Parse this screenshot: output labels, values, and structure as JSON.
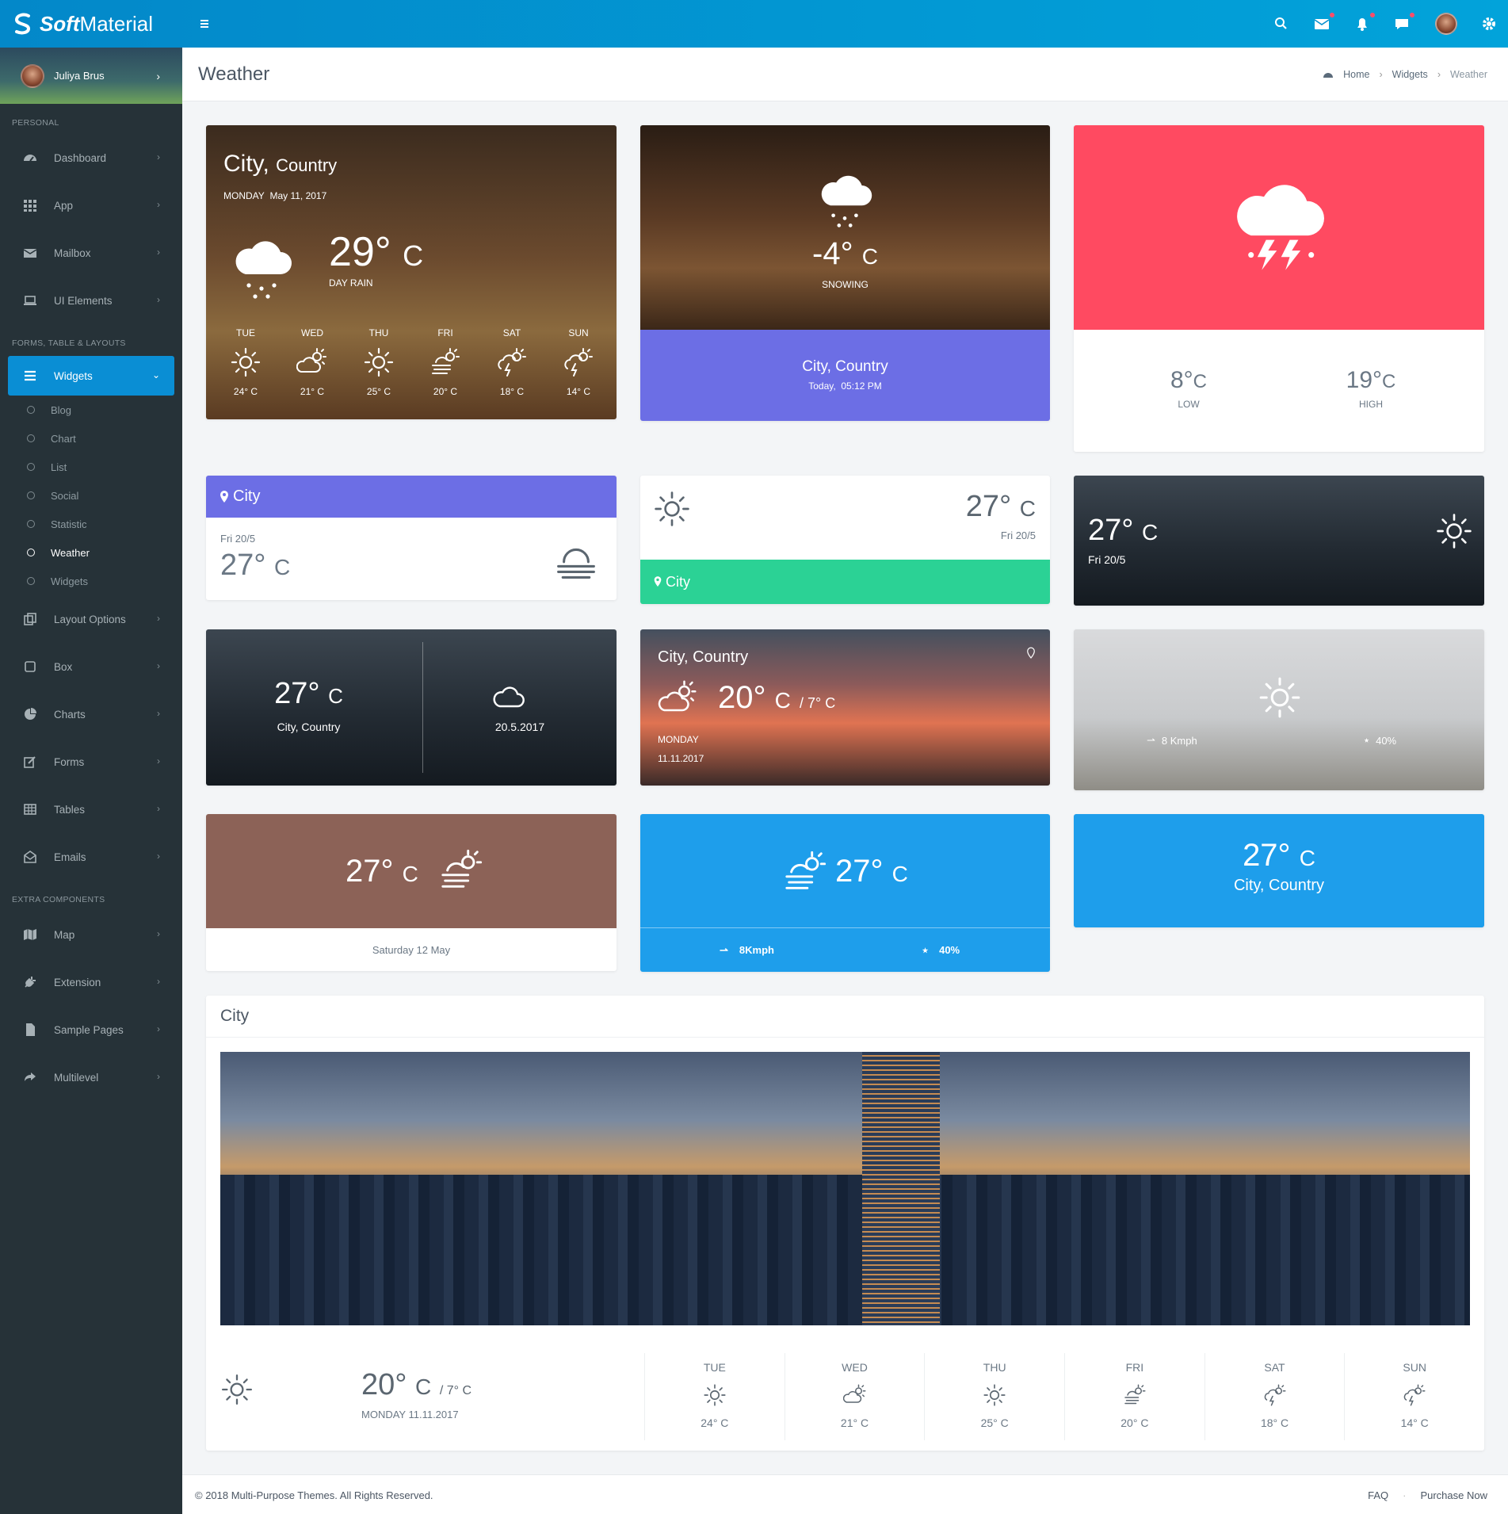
{
  "app": {
    "brand_bold": "Soft",
    "brand_rest": "Material"
  },
  "user": {
    "name": "Juliya Brus"
  },
  "sidebar": {
    "sections": [
      "PERSONAL",
      "FORMS, TABLE & LAYOUTS",
      "EXTRA COMPONENTS"
    ],
    "personal": [
      {
        "label": "Dashboard"
      },
      {
        "label": "App"
      },
      {
        "label": "Mailbox"
      },
      {
        "label": "UI Elements"
      }
    ],
    "widgets_label": "Widgets",
    "widgets_sub": [
      "Blog",
      "Chart",
      "List",
      "Social",
      "Statistic",
      "Weather",
      "Widgets"
    ],
    "forms": [
      {
        "label": "Layout Options"
      },
      {
        "label": "Box"
      },
      {
        "label": "Charts"
      },
      {
        "label": "Forms"
      },
      {
        "label": "Tables"
      },
      {
        "label": "Emails"
      }
    ],
    "extra": [
      {
        "label": "Map"
      },
      {
        "label": "Extension"
      },
      {
        "label": "Sample Pages"
      },
      {
        "label": "Multilevel"
      }
    ]
  },
  "page": {
    "title": "Weather",
    "crumbs": [
      "Home",
      "Widgets",
      "Weather"
    ]
  },
  "w1": {
    "city": "City,",
    "country": "Country",
    "day": "MONDAY",
    "date": "May 11, 2017",
    "temp": "29°",
    "unit": "C",
    "desc": "DAY RAIN",
    "days": [
      {
        "d": "TUE",
        "t": "24° C"
      },
      {
        "d": "WED",
        "t": "21° C"
      },
      {
        "d": "THU",
        "t": "25° C"
      },
      {
        "d": "FRI",
        "t": "20° C"
      },
      {
        "d": "SAT",
        "t": "18° C"
      },
      {
        "d": "SUN",
        "t": "14° C"
      }
    ]
  },
  "w2": {
    "temp": "-4°",
    "unit": "C",
    "desc": "SNOWING",
    "loc": "City, Country",
    "when": "Today,",
    "time": "05:12 PM"
  },
  "w3": {
    "low": "8°",
    "low_unit": "C",
    "low_label": "LOW",
    "high": "19°",
    "high_unit": "C",
    "high_label": "HIGH"
  },
  "w4": {
    "city": "City",
    "date": "Fri 20/5",
    "temp": "27°",
    "unit": "C"
  },
  "w5": {
    "temp": "27°",
    "unit": "C",
    "date": "Fri 20/5",
    "city": "City"
  },
  "w6": {
    "temp": "27°",
    "unit": "C",
    "date": "Fri 20/5"
  },
  "w7": {
    "temp": "27°",
    "unit": "C",
    "loc": "City, Country",
    "date": "20.5.2017"
  },
  "w8": {
    "loc": "City, Country",
    "temp": "20°",
    "unit": "C",
    "low": "/ 7° C",
    "day": "MONDAY",
    "date": "11.11.2017"
  },
  "w9": {
    "wind": "8 Kmph",
    "hum": "40%"
  },
  "w10": {
    "temp": "27°",
    "unit": "C",
    "date": "Saturday 12 May"
  },
  "w11": {
    "temp": "27°",
    "unit": "C",
    "wind": "8Kmph",
    "hum": "40%"
  },
  "w12": {
    "temp": "27°",
    "unit": "C",
    "loc": "City, Country"
  },
  "big": {
    "title": "City",
    "temp": "20°",
    "unit": "C",
    "low": "/ 7° C",
    "day": "MONDAY 11.11.2017",
    "days": [
      {
        "d": "TUE",
        "t": "24° C"
      },
      {
        "d": "WED",
        "t": "21° C"
      },
      {
        "d": "THU",
        "t": "25° C"
      },
      {
        "d": "FRI",
        "t": "20° C"
      },
      {
        "d": "SAT",
        "t": "18° C"
      },
      {
        "d": "SUN",
        "t": "14° C"
      }
    ]
  },
  "footer": {
    "copy": "© 2018 Multi-Purpose Themes. All Rights Reserved.",
    "faq": "FAQ",
    "purchase": "Purchase Now"
  }
}
